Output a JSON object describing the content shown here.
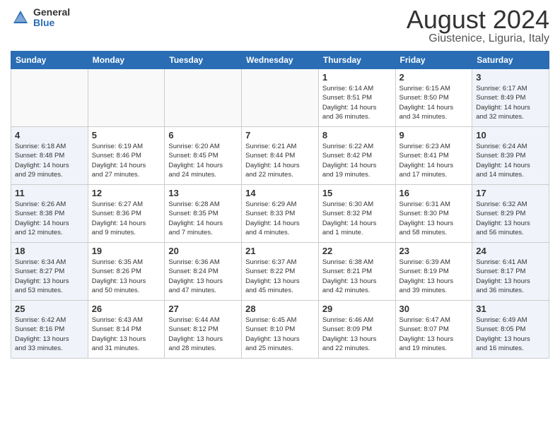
{
  "logo": {
    "general": "General",
    "blue": "Blue"
  },
  "header": {
    "month": "August 2024",
    "location": "Giustenice, Liguria, Italy"
  },
  "weekdays": [
    "Sunday",
    "Monday",
    "Tuesday",
    "Wednesday",
    "Thursday",
    "Friday",
    "Saturday"
  ],
  "weeks": [
    [
      {
        "day": "",
        "info": ""
      },
      {
        "day": "",
        "info": ""
      },
      {
        "day": "",
        "info": ""
      },
      {
        "day": "",
        "info": ""
      },
      {
        "day": "1",
        "info": "Sunrise: 6:14 AM\nSunset: 8:51 PM\nDaylight: 14 hours\nand 36 minutes."
      },
      {
        "day": "2",
        "info": "Sunrise: 6:15 AM\nSunset: 8:50 PM\nDaylight: 14 hours\nand 34 minutes."
      },
      {
        "day": "3",
        "info": "Sunrise: 6:17 AM\nSunset: 8:49 PM\nDaylight: 14 hours\nand 32 minutes."
      }
    ],
    [
      {
        "day": "4",
        "info": "Sunrise: 6:18 AM\nSunset: 8:48 PM\nDaylight: 14 hours\nand 29 minutes."
      },
      {
        "day": "5",
        "info": "Sunrise: 6:19 AM\nSunset: 8:46 PM\nDaylight: 14 hours\nand 27 minutes."
      },
      {
        "day": "6",
        "info": "Sunrise: 6:20 AM\nSunset: 8:45 PM\nDaylight: 14 hours\nand 24 minutes."
      },
      {
        "day": "7",
        "info": "Sunrise: 6:21 AM\nSunset: 8:44 PM\nDaylight: 14 hours\nand 22 minutes."
      },
      {
        "day": "8",
        "info": "Sunrise: 6:22 AM\nSunset: 8:42 PM\nDaylight: 14 hours\nand 19 minutes."
      },
      {
        "day": "9",
        "info": "Sunrise: 6:23 AM\nSunset: 8:41 PM\nDaylight: 14 hours\nand 17 minutes."
      },
      {
        "day": "10",
        "info": "Sunrise: 6:24 AM\nSunset: 8:39 PM\nDaylight: 14 hours\nand 14 minutes."
      }
    ],
    [
      {
        "day": "11",
        "info": "Sunrise: 6:26 AM\nSunset: 8:38 PM\nDaylight: 14 hours\nand 12 minutes."
      },
      {
        "day": "12",
        "info": "Sunrise: 6:27 AM\nSunset: 8:36 PM\nDaylight: 14 hours\nand 9 minutes."
      },
      {
        "day": "13",
        "info": "Sunrise: 6:28 AM\nSunset: 8:35 PM\nDaylight: 14 hours\nand 7 minutes."
      },
      {
        "day": "14",
        "info": "Sunrise: 6:29 AM\nSunset: 8:33 PM\nDaylight: 14 hours\nand 4 minutes."
      },
      {
        "day": "15",
        "info": "Sunrise: 6:30 AM\nSunset: 8:32 PM\nDaylight: 14 hours\nand 1 minute."
      },
      {
        "day": "16",
        "info": "Sunrise: 6:31 AM\nSunset: 8:30 PM\nDaylight: 13 hours\nand 58 minutes."
      },
      {
        "day": "17",
        "info": "Sunrise: 6:32 AM\nSunset: 8:29 PM\nDaylight: 13 hours\nand 56 minutes."
      }
    ],
    [
      {
        "day": "18",
        "info": "Sunrise: 6:34 AM\nSunset: 8:27 PM\nDaylight: 13 hours\nand 53 minutes."
      },
      {
        "day": "19",
        "info": "Sunrise: 6:35 AM\nSunset: 8:26 PM\nDaylight: 13 hours\nand 50 minutes."
      },
      {
        "day": "20",
        "info": "Sunrise: 6:36 AM\nSunset: 8:24 PM\nDaylight: 13 hours\nand 47 minutes."
      },
      {
        "day": "21",
        "info": "Sunrise: 6:37 AM\nSunset: 8:22 PM\nDaylight: 13 hours\nand 45 minutes."
      },
      {
        "day": "22",
        "info": "Sunrise: 6:38 AM\nSunset: 8:21 PM\nDaylight: 13 hours\nand 42 minutes."
      },
      {
        "day": "23",
        "info": "Sunrise: 6:39 AM\nSunset: 8:19 PM\nDaylight: 13 hours\nand 39 minutes."
      },
      {
        "day": "24",
        "info": "Sunrise: 6:41 AM\nSunset: 8:17 PM\nDaylight: 13 hours\nand 36 minutes."
      }
    ],
    [
      {
        "day": "25",
        "info": "Sunrise: 6:42 AM\nSunset: 8:16 PM\nDaylight: 13 hours\nand 33 minutes."
      },
      {
        "day": "26",
        "info": "Sunrise: 6:43 AM\nSunset: 8:14 PM\nDaylight: 13 hours\nand 31 minutes."
      },
      {
        "day": "27",
        "info": "Sunrise: 6:44 AM\nSunset: 8:12 PM\nDaylight: 13 hours\nand 28 minutes."
      },
      {
        "day": "28",
        "info": "Sunrise: 6:45 AM\nSunset: 8:10 PM\nDaylight: 13 hours\nand 25 minutes."
      },
      {
        "day": "29",
        "info": "Sunrise: 6:46 AM\nSunset: 8:09 PM\nDaylight: 13 hours\nand 22 minutes."
      },
      {
        "day": "30",
        "info": "Sunrise: 6:47 AM\nSunset: 8:07 PM\nDaylight: 13 hours\nand 19 minutes."
      },
      {
        "day": "31",
        "info": "Sunrise: 6:49 AM\nSunset: 8:05 PM\nDaylight: 13 hours\nand 16 minutes."
      }
    ]
  ]
}
